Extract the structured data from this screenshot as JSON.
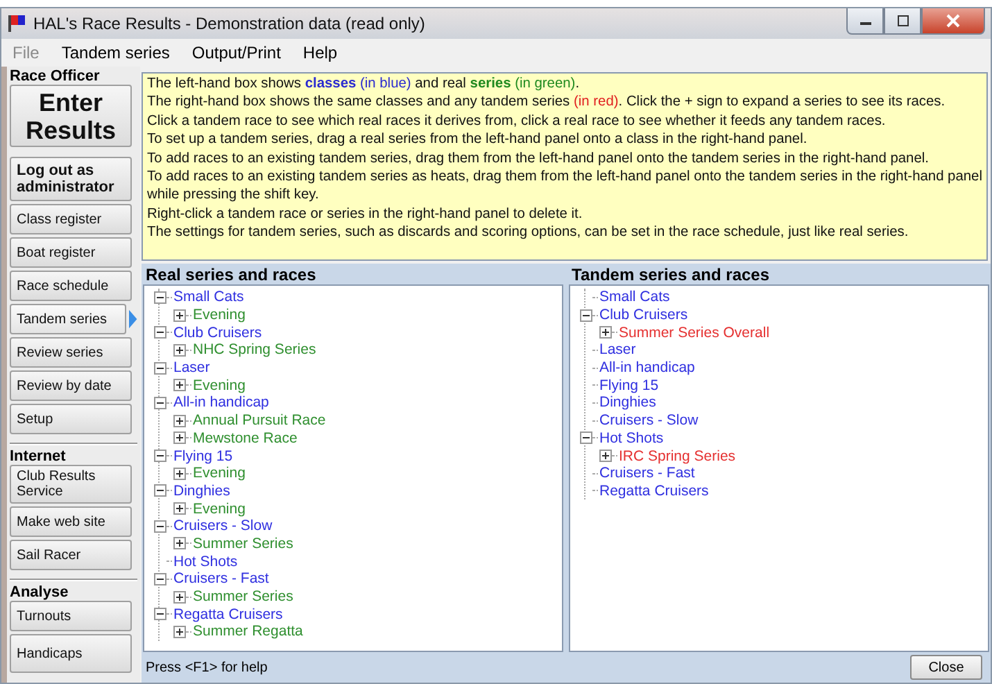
{
  "window": {
    "title": "HAL's Race Results - Demonstration data (read only)"
  },
  "menu": [
    {
      "label": "File",
      "disabled": true
    },
    {
      "label": "Tandem series",
      "disabled": false
    },
    {
      "label": "Output/Print",
      "disabled": false
    },
    {
      "label": "Help",
      "disabled": false
    }
  ],
  "sidebar": [
    {
      "heading": "Race Officer",
      "buttons": [
        {
          "label": "Enter Results",
          "kind": "large",
          "selected": false
        },
        {
          "label": "Log out as administrator",
          "kind": "bold",
          "selected": false
        },
        {
          "label": "Class register",
          "kind": "normal",
          "selected": false
        },
        {
          "label": "Boat register",
          "kind": "normal",
          "selected": false
        },
        {
          "label": "Race schedule",
          "kind": "normal",
          "selected": false
        },
        {
          "label": "Tandem series",
          "kind": "normal",
          "selected": true
        },
        {
          "label": "Review series",
          "kind": "normal",
          "selected": false
        },
        {
          "label": "Review by date",
          "kind": "normal",
          "selected": false
        },
        {
          "label": "Setup",
          "kind": "normal",
          "selected": false
        }
      ]
    },
    {
      "heading": "Internet",
      "buttons": [
        {
          "label": "Club Results Service",
          "kind": "tall",
          "selected": false
        },
        {
          "label": "Make web site",
          "kind": "normal",
          "selected": false
        },
        {
          "label": "Sail Racer",
          "kind": "normal",
          "selected": false
        }
      ]
    },
    {
      "heading": "Analyse",
      "buttons": [
        {
          "label": "Turnouts",
          "kind": "normal",
          "selected": false
        },
        {
          "label": "Handicaps",
          "kind": "tall",
          "selected": false
        }
      ]
    }
  ],
  "info": [
    [
      {
        "text": "The left-hand box shows ",
        "kind": "plain"
      },
      {
        "text": "**classes**",
        "kind": "class"
      },
      {
        "text": " (in blue)",
        "kind": "class"
      },
      {
        "text": " and real ",
        "kind": "plain"
      },
      {
        "text": "**series**",
        "kind": "series"
      },
      {
        "text": " (in green)",
        "kind": "series"
      },
      {
        "text": ".",
        "kind": "plain"
      }
    ],
    [
      {
        "text": "The right-hand box shows the same classes and any tandem series ",
        "kind": "plain"
      },
      {
        "text": "(in red)",
        "kind": "tandem"
      },
      {
        "text": ".  Click the + sign to expand a series to see its races.",
        "kind": "plain"
      }
    ],
    [
      {
        "text": "Click a tandem race to see which real races it derives from, click a real race to see whether it feeds any tandem races.",
        "kind": "plain"
      }
    ],
    [
      {
        "text": "To set up a tandem series, drag a real series from the left-hand panel onto a class in the right-hand panel.",
        "kind": "plain"
      }
    ],
    [
      {
        "text": "To add races to an existing tandem series, drag them from the left-hand panel onto the tandem series in the right-hand panel.",
        "kind": "plain"
      }
    ],
    [
      {
        "text": "To add races to an existing tandem series as heats, drag them from the left-hand panel onto the tandem series in the right-hand panel while pressing the shift key.",
        "kind": "plain"
      }
    ],
    [
      {
        "text": "Right-click a tandem race or series in the right-hand panel to delete it.",
        "kind": "plain"
      }
    ],
    [
      {
        "text": "The settings for tandem series, such as discards and scoring options, can be set in the race schedule, just like real series.",
        "kind": "plain"
      }
    ]
  ],
  "panels": [
    {
      "title": "Real series and races",
      "tree": [
        {
          "label": "Small Cats",
          "kind": "class",
          "expanded": true,
          "children": [
            {
              "label": "Evening",
              "kind": "series",
              "expanded": false
            }
          ]
        },
        {
          "label": "Club Cruisers",
          "kind": "class",
          "expanded": true,
          "children": [
            {
              "label": "NHC Spring Series",
              "kind": "series",
              "expanded": false
            }
          ]
        },
        {
          "label": "Laser",
          "kind": "class",
          "expanded": true,
          "children": [
            {
              "label": "Evening",
              "kind": "series",
              "expanded": false
            }
          ]
        },
        {
          "label": "All-in handicap",
          "kind": "class",
          "expanded": true,
          "children": [
            {
              "label": "Annual Pursuit Race",
              "kind": "series",
              "expanded": false
            },
            {
              "label": "Mewstone Race",
              "kind": "series",
              "expanded": false
            }
          ]
        },
        {
          "label": "Flying 15",
          "kind": "class",
          "expanded": true,
          "children": [
            {
              "label": "Evening",
              "kind": "series",
              "expanded": false
            }
          ]
        },
        {
          "label": "Dinghies",
          "kind": "class",
          "expanded": true,
          "children": [
            {
              "label": "Evening",
              "kind": "series",
              "expanded": false
            }
          ]
        },
        {
          "label": "Cruisers - Slow",
          "kind": "class",
          "expanded": true,
          "children": [
            {
              "label": "Summer Series",
              "kind": "series",
              "expanded": false
            }
          ]
        },
        {
          "label": "Hot Shots",
          "kind": "class"
        },
        {
          "label": "Cruisers - Fast",
          "kind": "class",
          "expanded": true,
          "children": [
            {
              "label": "Summer Series",
              "kind": "series",
              "expanded": false
            }
          ]
        },
        {
          "label": "Regatta Cruisers",
          "kind": "class",
          "expanded": true,
          "children": [
            {
              "label": "Summer Regatta",
              "kind": "series",
              "expanded": false
            }
          ]
        }
      ]
    },
    {
      "title": "Tandem series and races",
      "tree": [
        {
          "label": "Small Cats",
          "kind": "class"
        },
        {
          "label": "Club Cruisers",
          "kind": "class",
          "expanded": true,
          "children": [
            {
              "label": "Summer Series Overall",
              "kind": "tandem",
              "expanded": false
            }
          ]
        },
        {
          "label": "Laser",
          "kind": "class"
        },
        {
          "label": "All-in handicap",
          "kind": "class"
        },
        {
          "label": "Flying 15",
          "kind": "class"
        },
        {
          "label": "Dinghies",
          "kind": "class"
        },
        {
          "label": "Cruisers - Slow",
          "kind": "class"
        },
        {
          "label": "Hot Shots",
          "kind": "class",
          "expanded": true,
          "children": [
            {
              "label": "IRC Spring Series",
              "kind": "tandem",
              "expanded": false
            }
          ]
        },
        {
          "label": "Cruisers - Fast",
          "kind": "class"
        },
        {
          "label": "Regatta Cruisers",
          "kind": "class"
        }
      ]
    }
  ],
  "status_bar": {
    "text": "Press <F1> for help",
    "button": "Close"
  }
}
